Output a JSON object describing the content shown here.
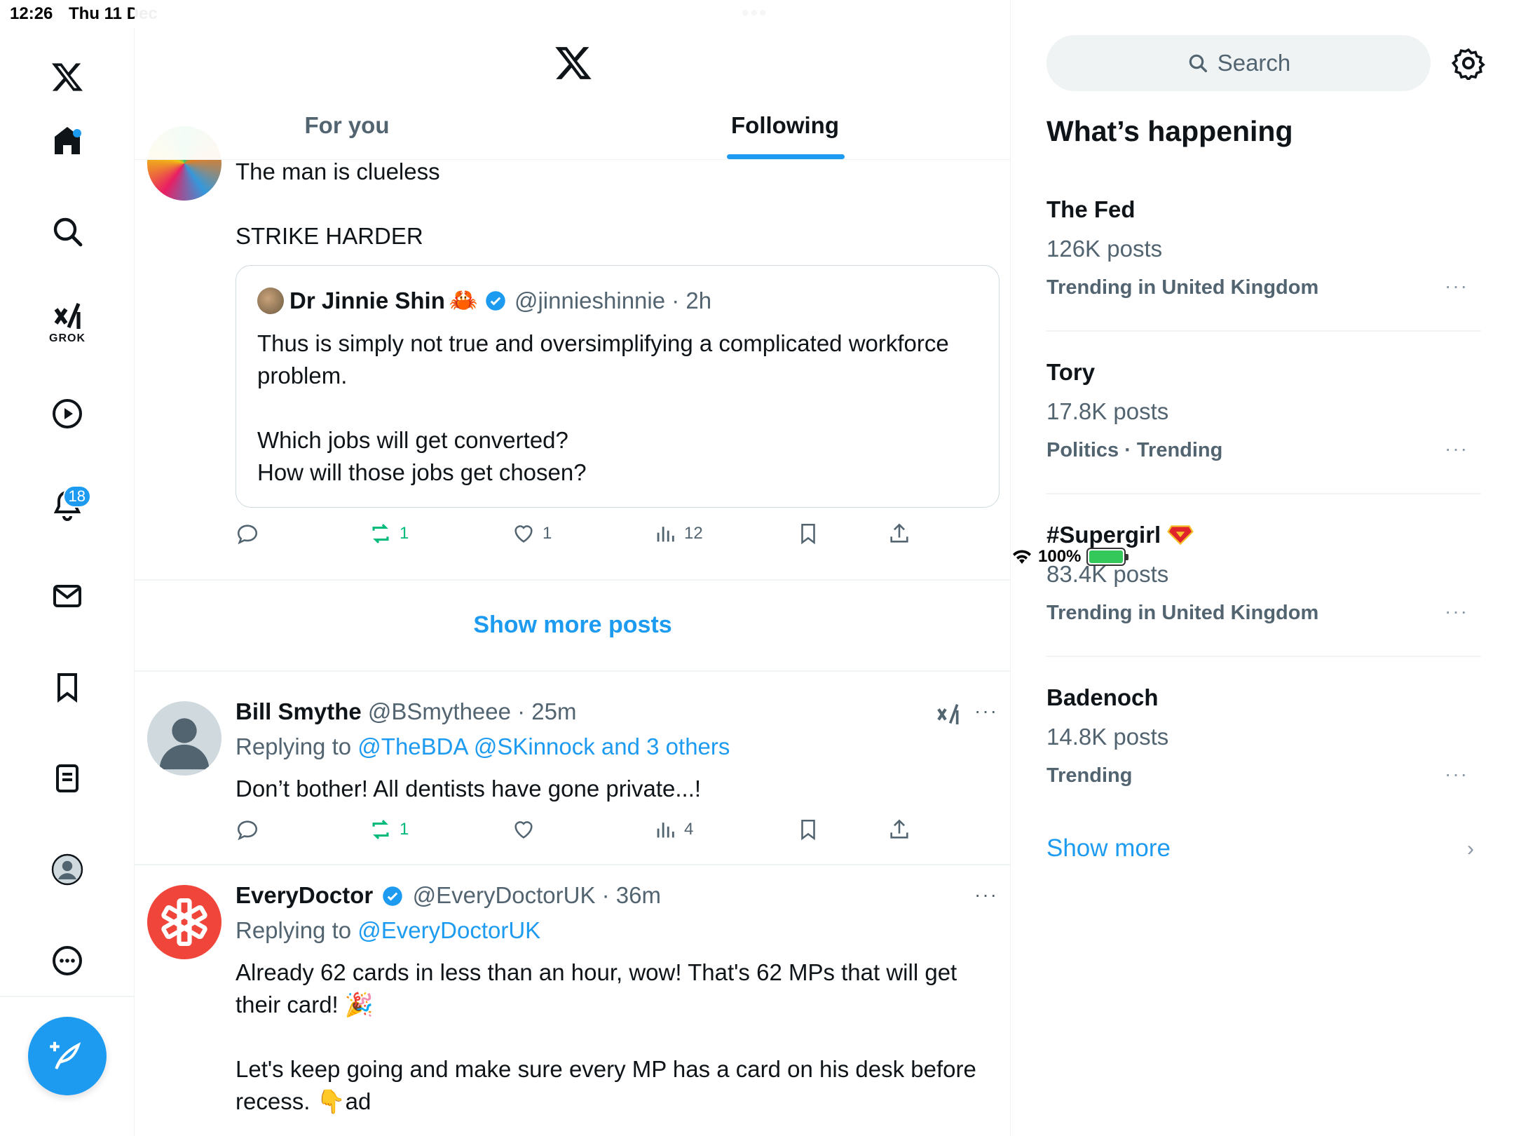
{
  "status_bar": {
    "time": "12:26",
    "date": "Thu 11 Dec",
    "battery": "100%"
  },
  "nav": {
    "notifications_count": "18",
    "grok_label": "GROK"
  },
  "header": {
    "tabs": [
      {
        "label": "For you"
      },
      {
        "label": "Following"
      }
    ],
    "active_tab": "Following"
  },
  "feed": {
    "post1": {
      "text": "The man is clueless\n\nSTRIKE HARDER",
      "quote": {
        "name": "Dr Jinnie Shin",
        "emoji": "🦀",
        "handle_time": "@jinnieshinnie · 2h",
        "text": "Thus is simply not true and oversimplifying a complicated workforce problem.\n\nWhich jobs will get converted?\nHow will those jobs get chosen?"
      },
      "retweets": "1",
      "likes": "1",
      "views": "12"
    },
    "show_more_posts": "Show more posts",
    "post2": {
      "name": "Bill Smythe",
      "handle_time": "@BSmytheee · 25m",
      "replying_prefix": "Replying to",
      "replying_to": "@TheBDA @SKinnock and 3 others",
      "text": "Don’t bother! All dentists have gone private...!",
      "retweets": "1",
      "likes": "",
      "views": "4"
    },
    "post3": {
      "name": "EveryDoctor",
      "handle_time": "@EveryDoctorUK · 36m",
      "replying_prefix": "Replying to",
      "replying_to": "@EveryDoctorUK",
      "text": "Already 62 cards in less than an hour, wow! That's 62 MPs that will get their card! 🎉\n\nLet's keep going and make sure every MP has a card on his desk before recess. 👇ad"
    }
  },
  "sidebar": {
    "search_placeholder": "Search",
    "whats_happening": "What’s happening",
    "trends": [
      {
        "name": "The Fed",
        "count": "126K posts",
        "context": "Trending in United Kingdom"
      },
      {
        "name": "Tory",
        "count": "17.8K posts",
        "context": "Politics · Trending"
      },
      {
        "name": "#Supergirl",
        "count": "83.4K posts",
        "context": "Trending in United Kingdom"
      },
      {
        "name": "Badenoch",
        "count": "14.8K posts",
        "context": "Trending"
      }
    ],
    "show_more": "Show more"
  },
  "colors": {
    "accent": "#1d9bf0",
    "retweet": "#00ba7c",
    "muted": "#536471"
  }
}
